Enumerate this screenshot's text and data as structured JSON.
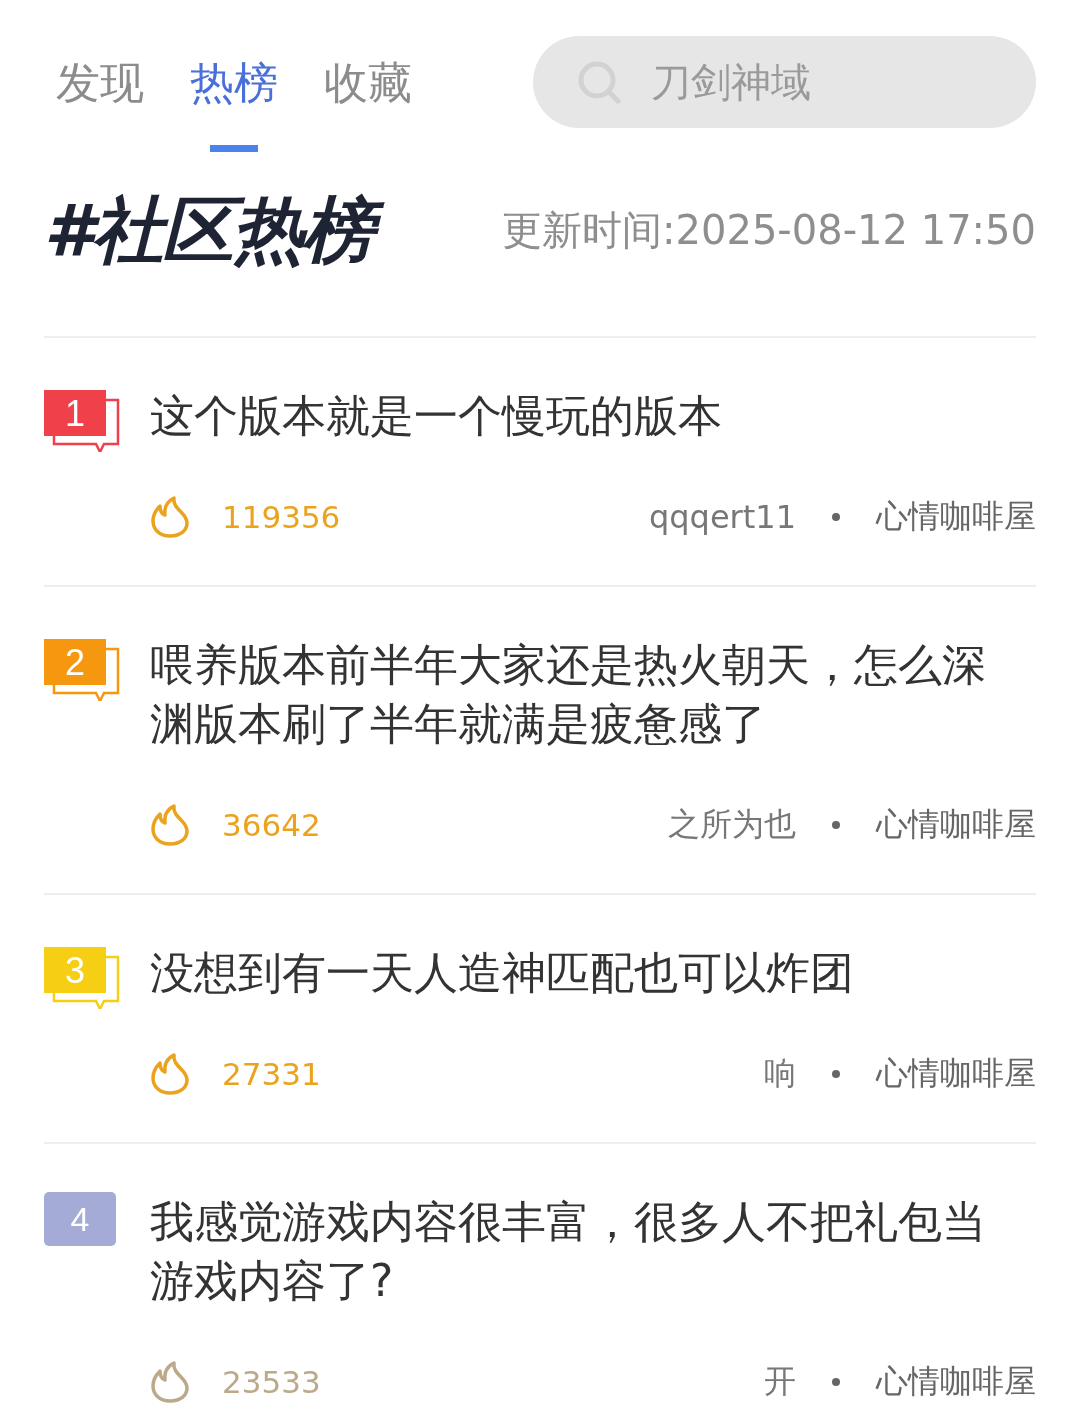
{
  "tabs": [
    {
      "label": "发现",
      "selected": false
    },
    {
      "label": "热榜",
      "selected": true
    },
    {
      "label": "收藏",
      "selected": false
    }
  ],
  "search": {
    "placeholder": "刀剑神域"
  },
  "header": {
    "title": "#社区热榜",
    "updated": "更新时间:2025-08-12 17:50"
  },
  "posts": [
    {
      "rank": "1",
      "kind": "top",
      "color": "#f0404a",
      "title": "这个版本就是一个慢玩的版本",
      "heat": "119356",
      "author": "qqqert11",
      "board": "心情咖啡屋"
    },
    {
      "rank": "2",
      "kind": "top",
      "color": "#f5970f",
      "title": "喂养版本前半年大家还是热火朝天，怎么深渊版本刷了半年就满是疲惫感了",
      "heat": "36642",
      "author": "之所为也",
      "board": "心情咖啡屋"
    },
    {
      "rank": "3",
      "kind": "top",
      "color": "#f6ce13",
      "title": "没想到有一天人造神匹配也可以炸团",
      "heat": "27331",
      "author": "响",
      "board": "心情咖啡屋"
    },
    {
      "rank": "4",
      "kind": "plain",
      "color": "#a3abd6",
      "title": "我感觉游戏内容很丰富，很多人不把礼包当游戏内容了?",
      "heat": "23533",
      "author": "开",
      "board": "心情咖啡屋"
    }
  ]
}
